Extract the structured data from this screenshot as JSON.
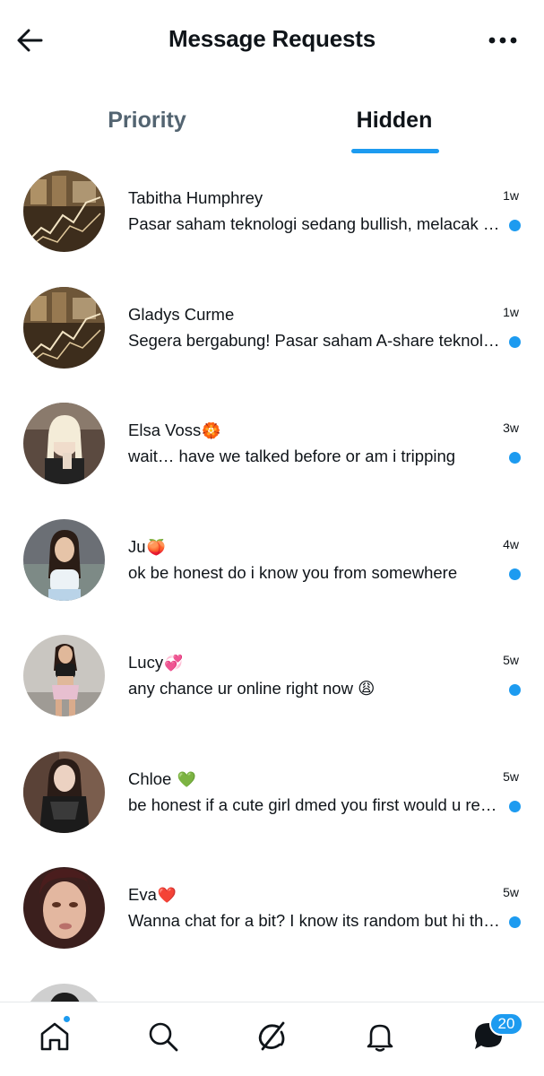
{
  "header": {
    "title": "Message Requests",
    "back_icon": "arrow-left-icon",
    "more_icon": "more-horizontal-icon"
  },
  "tabs": [
    {
      "label": "Priority",
      "active": false
    },
    {
      "label": "Hidden",
      "active": true
    }
  ],
  "conversations": [
    {
      "name": "Tabitha Humphrey",
      "emoji": "",
      "time": "1w",
      "preview": "Pasar saham teknologi sedang bullish, melacak tren pasar",
      "unread": true
    },
    {
      "name": "Gladys Curme",
      "emoji": "",
      "time": "1w",
      "preview": "Segera bergabung! Pasar saham A-share teknologi",
      "unread": true
    },
    {
      "name": "Elsa Voss",
      "emoji": "🏵️",
      "time": "3w",
      "preview": "wait… have we talked before or am i tripping",
      "unread": true
    },
    {
      "name": "Ju",
      "emoji": "🍑",
      "time": "4w",
      "preview": "ok be honest do i know you from somewhere",
      "unread": true
    },
    {
      "name": "Lucy",
      "emoji": "💞",
      "time": "5w",
      "preview": "any chance ur online right now 😩",
      "unread": true
    },
    {
      "name": "Chloe ",
      "emoji": "💚",
      "time": "5w",
      "preview": "be honest if a cute girl dmed you first would u reply",
      "unread": true
    },
    {
      "name": "Eva",
      "emoji": "❤️",
      "time": "5w",
      "preview": "Wanna chat for a bit? I know its random but hi there",
      "unread": true
    }
  ],
  "bottom_nav": {
    "items": [
      "home-icon",
      "search-icon",
      "grok-icon",
      "bell-icon",
      "messages-icon"
    ],
    "messages_badge": "20",
    "accent": "#1d9bf0"
  }
}
